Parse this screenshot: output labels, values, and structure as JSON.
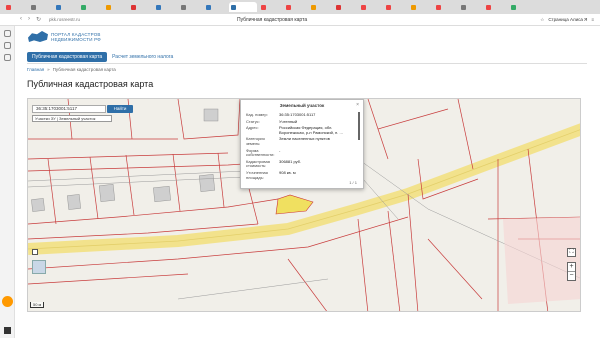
{
  "browser": {
    "address": "pkk.rosreestr.ru",
    "title": "Публичная кадастровая карта",
    "user": "Страница Алиса Я",
    "tabs": [
      "",
      "",
      "",
      "",
      "",
      "",
      "",
      "",
      "",
      "",
      "",
      "",
      "",
      "",
      "",
      "",
      "",
      "",
      "",
      "",
      ""
    ]
  },
  "site": {
    "logo_line1": "ПОРТАЛ КАДАСТРОВ",
    "logo_line2": "НЕДВИЖИМОСТИ РФ",
    "nav_primary": "Публичная кадастровая карта",
    "nav_secondary": "Расчет земельного налога",
    "breadcrumb_home": "Главная",
    "breadcrumb_sep": "»",
    "breadcrumb_current": "Публичная кадастровая карта",
    "page_title": "Публичная кадастровая карта"
  },
  "map": {
    "search_value": "36:35:1703001:5117",
    "find_label": "Найти",
    "layer_select": "Участки ЗУ | Земельный участок",
    "scale_label": "50 м",
    "fullscreen_icon": "⛶",
    "zoom_in": "+",
    "zoom_out": "−"
  },
  "popup": {
    "title": "Земельный участок",
    "rows": [
      {
        "k": "Кад. номер:",
        "v": "36:35:1703001:5117"
      },
      {
        "k": "Статус:",
        "v": "Учтенный"
      },
      {
        "k": "Адрес:",
        "v": "Российская Федерация, обл. Воронежская, р-н Рамонский, п. ..."
      },
      {
        "k": "Категория земель:",
        "v": "Земли населенных пунктов"
      },
      {
        "k": "Форма собственности:",
        "v": "-"
      },
      {
        "k": "Кадастровая стоимость:",
        "v": "306881 руб."
      },
      {
        "k": "Уточненная площадь:",
        "v": "908 кв. м"
      }
    ],
    "pager": "1 / 1"
  }
}
